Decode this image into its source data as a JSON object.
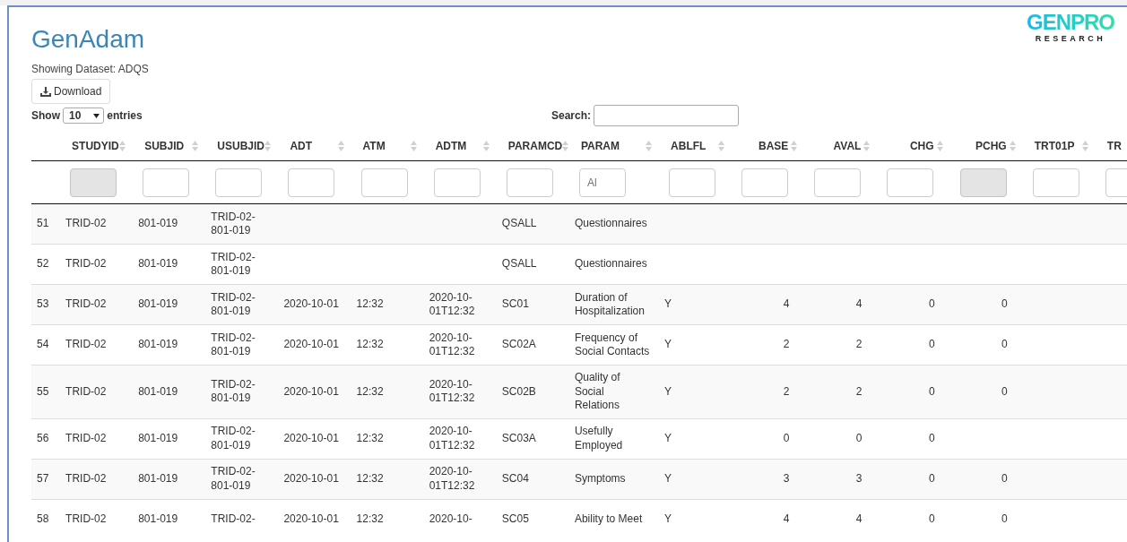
{
  "app": {
    "title": "GenAdam",
    "dataset_label": "Showing Dataset: ADQS",
    "download_button": "Download",
    "logo": {
      "name": "GENPRO",
      "tagline": "RESEARCH"
    }
  },
  "length_menu": {
    "before": "Show",
    "value": "10",
    "after": "entries"
  },
  "search": {
    "label": "Search:"
  },
  "columns": [
    {
      "label": "STUDYID",
      "kind": "text",
      "sortable": true
    },
    {
      "label": "SUBJID",
      "kind": "text",
      "sortable": true
    },
    {
      "label": "USUBJID",
      "kind": "text",
      "sortable": true
    },
    {
      "label": "ADT",
      "kind": "text",
      "sortable": true
    },
    {
      "label": "ATM",
      "kind": "text",
      "sortable": true
    },
    {
      "label": "ADTM",
      "kind": "text",
      "sortable": true
    },
    {
      "label": "PARAMCD",
      "kind": "text",
      "sortable": true
    },
    {
      "label": "PARAM",
      "kind": "text",
      "sortable": true
    },
    {
      "label": "ABLFL",
      "kind": "text",
      "sortable": true
    },
    {
      "label": "BASE",
      "kind": "numeric",
      "sortable": true
    },
    {
      "label": "AVAL",
      "kind": "numeric",
      "sortable": true
    },
    {
      "label": "CHG",
      "kind": "numeric",
      "sortable": true
    },
    {
      "label": "PCHG",
      "kind": "numeric",
      "sortable": true
    },
    {
      "label": "TRT01P",
      "kind": "text",
      "sortable": true
    },
    {
      "label": "TR",
      "kind": "text"
    }
  ],
  "filters": [
    {
      "disabled": true
    },
    {
      "disabled": false
    },
    {
      "disabled": false
    },
    {
      "disabled": false
    },
    {
      "disabled": false
    },
    {
      "disabled": false
    },
    {
      "disabled": false
    },
    {
      "disabled": false,
      "placeholder": "Al"
    },
    {
      "disabled": false
    },
    {
      "disabled": false
    },
    {
      "disabled": false
    },
    {
      "disabled": false
    },
    {
      "disabled": true
    },
    {
      "disabled": false
    },
    {
      "disabled": false
    }
  ],
  "rows": [
    [
      "51",
      "TRID-02",
      "801-019",
      "TRID-02-801-019",
      "",
      "",
      "",
      "QSALL",
      "Questionnaires",
      "",
      "",
      "",
      "",
      "",
      "",
      ""
    ],
    [
      "52",
      "TRID-02",
      "801-019",
      "TRID-02-801-019",
      "",
      "",
      "",
      "QSALL",
      "Questionnaires",
      "",
      "",
      "",
      "",
      "",
      "",
      ""
    ],
    [
      "53",
      "TRID-02",
      "801-019",
      "TRID-02-801-019",
      "2020-10-01",
      "12:32",
      "2020-10-01T12:32",
      "SC01",
      "Duration of Hospitalization",
      "Y",
      "4",
      "4",
      "0",
      "0",
      "",
      ""
    ],
    [
      "54",
      "TRID-02",
      "801-019",
      "TRID-02-801-019",
      "2020-10-01",
      "12:32",
      "2020-10-01T12:32",
      "SC02A",
      "Frequency of Social Contacts",
      "Y",
      "2",
      "2",
      "0",
      "0",
      "",
      ""
    ],
    [
      "55",
      "TRID-02",
      "801-019",
      "TRID-02-801-019",
      "2020-10-01",
      "12:32",
      "2020-10-01T12:32",
      "SC02B",
      "Quality of Social Relations",
      "Y",
      "2",
      "2",
      "0",
      "0",
      "",
      ""
    ],
    [
      "56",
      "TRID-02",
      "801-019",
      "TRID-02-801-019",
      "2020-10-01",
      "12:32",
      "2020-10-01T12:32",
      "SC03A",
      "Usefully Employed",
      "Y",
      "0",
      "0",
      "0",
      "",
      "",
      ""
    ],
    [
      "57",
      "TRID-02",
      "801-019",
      "TRID-02-801-019",
      "2020-10-01",
      "12:32",
      "2020-10-01T12:32",
      "SC04",
      "Symptoms",
      "Y",
      "3",
      "3",
      "0",
      "0",
      "",
      ""
    ],
    [
      "58",
      "TRID-02",
      "801-019",
      "TRID-02-",
      "2020-10-01",
      "12:32",
      "2020-10-",
      "SC05",
      "Ability to Meet",
      "Y",
      "4",
      "4",
      "0",
      "0",
      "",
      ""
    ]
  ]
}
